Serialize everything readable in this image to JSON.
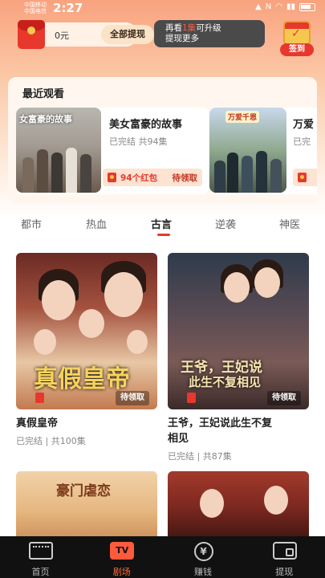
{
  "status_bar": {
    "carrier1": "中国移动",
    "carrier2": "中国电信",
    "time": "2:27"
  },
  "header": {
    "balance": "0元",
    "withdraw_label": "全部提现",
    "promo_pre": "再看",
    "promo_highlight": "1集",
    "promo_post": "可升级",
    "promo_line2": "提现更多",
    "checkin_label": "签到"
  },
  "recent": {
    "title": "最近观看",
    "items": [
      {
        "thumb_caption": "女富豪的故事",
        "name": "美女富豪的故事",
        "meta": "已完结  共94集",
        "reward_count": "94个红包",
        "reward_claim": "待领取"
      },
      {
        "thumb_caption": "万爱千恩",
        "name": "万爱",
        "meta": "已完"
      }
    ]
  },
  "categories": [
    "都市",
    "热血",
    "古言",
    "逆袭",
    "神医"
  ],
  "active_category": "古言",
  "dramas": [
    {
      "poster_title": "真假皇帝",
      "reward_claim": "待领取",
      "name": "真假皇帝",
      "meta": "已完结 | 共100集"
    },
    {
      "poster_title": "王爷，王妃说",
      "poster_title2": "此生不复相见",
      "reward_claim": "待领取",
      "name_line1": "王爷，王妃说此生不复",
      "name_line2": "相见",
      "meta": "已完结 | 共87集"
    }
  ],
  "bottom_thumbs": [
    {
      "title": "豪门虐恋"
    },
    {
      "title": ""
    }
  ],
  "nav": {
    "items": [
      {
        "label": "首页",
        "icon": "film-icon"
      },
      {
        "label": "剧场",
        "icon": "tv-icon",
        "icon_text": "TV"
      },
      {
        "label": "赚钱",
        "icon": "yen-coin-icon",
        "icon_text": "¥"
      },
      {
        "label": "提现",
        "icon": "wallet-icon"
      }
    ],
    "active": "剧场"
  },
  "colors": {
    "accent": "#e8372c",
    "nav_active": "#ff6a3c",
    "header_gradient_top": "#f9a27e"
  }
}
